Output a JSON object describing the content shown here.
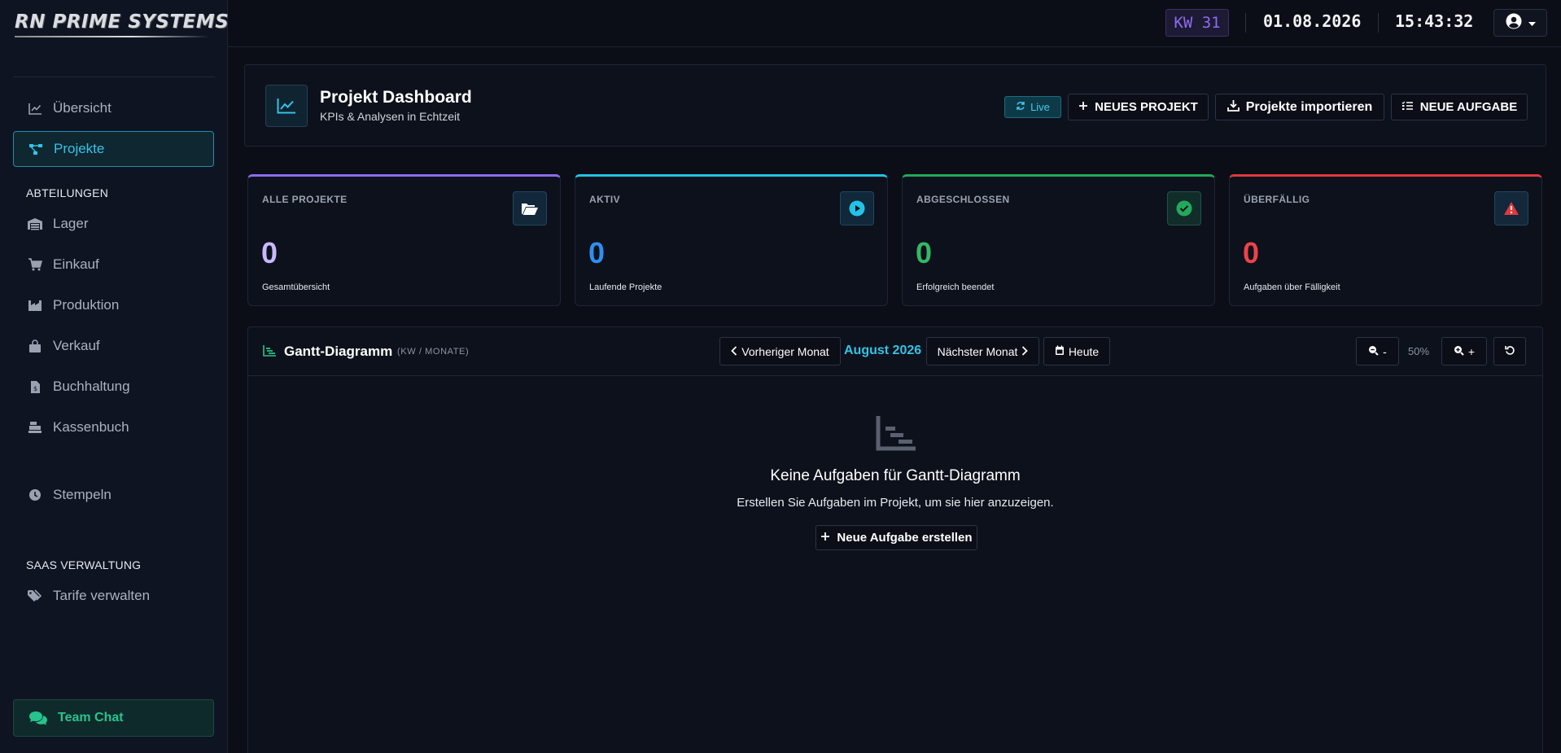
{
  "brand": {
    "logo_text": "RN PRIME SYSTEMS"
  },
  "sidebar": {
    "items": [
      {
        "label": "Übersicht",
        "icon": "chart-line-icon"
      },
      {
        "label": "Projekte",
        "icon": "project-diagram-icon",
        "active": true
      }
    ],
    "section_departments": "ABTEILUNGEN",
    "departments": [
      {
        "label": "Lager",
        "icon": "warehouse-icon"
      },
      {
        "label": "Einkauf",
        "icon": "cart-icon"
      },
      {
        "label": "Produktion",
        "icon": "industry-icon"
      },
      {
        "label": "Verkauf",
        "icon": "shopping-bag-icon"
      },
      {
        "label": "Buchhaltung",
        "icon": "invoice-icon"
      },
      {
        "label": "Kassenbuch",
        "icon": "cash-register-icon"
      }
    ],
    "stempeln": "Stempeln",
    "section_saas": "SAAS VERWALTUNG",
    "saas_items": [
      {
        "label": "Tarife verwalten",
        "icon": "tags-icon"
      }
    ],
    "team_chat": "Team Chat"
  },
  "topbar": {
    "week": "KW 31",
    "date": "01.08.2026",
    "time": "15:43:32"
  },
  "header": {
    "title": "Projekt Dashboard",
    "subtitle": "KPIs & Analysen in Echtzeit",
    "live": "Live",
    "new_project": "NEUES PROJEKT",
    "import": "Projekte importieren",
    "new_task": "NEUE AUFGABE"
  },
  "kpis": [
    {
      "label": "ALLE PROJEKTE",
      "value": "0",
      "desc": "Gesamtübersicht",
      "color": "#8e6bf0",
      "value_color": "#c9b8ff"
    },
    {
      "label": "AKTIV",
      "value": "0",
      "desc": "Laufende Projekte",
      "color": "#22c3e6",
      "value_color": "#2e8ff0"
    },
    {
      "label": "ABGESCHLOSSEN",
      "value": "0",
      "desc": "Erfolgreich beendet",
      "color": "#22a95a",
      "value_color": "#33b865"
    },
    {
      "label": "ÜBERFÄLLIG",
      "value": "0",
      "desc": "Aufgaben über Fälligkeit",
      "color": "#e0393e",
      "value_color": "#ee4249"
    }
  ],
  "gantt": {
    "title": "Gantt-Diagramm",
    "subtitle": "(KW / MONATE)",
    "prev": "Vorheriger Monat",
    "month": "August 2026",
    "next": "Nächster Monat",
    "today": "Heute",
    "zoom_out": "-",
    "zoom": "50%",
    "zoom_in": "+",
    "empty_title": "Keine Aufgaben für Gantt-Diagramm",
    "empty_sub": "Erstellen Sie Aufgaben im Projekt, um sie hier anzuzeigen.",
    "empty_button": "Neue Aufgabe erstellen"
  }
}
